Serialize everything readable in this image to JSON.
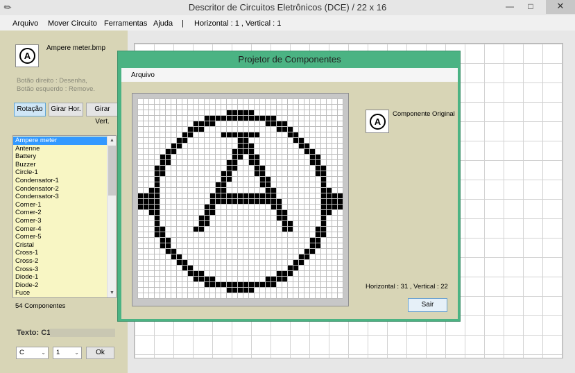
{
  "window": {
    "title": "Descritor de Circuitos Eletrônicos  (DCE) / 22 x 16",
    "min": "—",
    "max": "□",
    "close": "✕"
  },
  "menu": {
    "items": [
      "Arquivo",
      "Mover Circuito",
      "Ferramentas",
      "Ajuda"
    ],
    "separator": "|",
    "coords": "Horizontal : 1 , Vertical : 1"
  },
  "left": {
    "selected_icon_letter": "A",
    "selected_file": "Ampere meter.bmp",
    "hint1": "Botão direito : Desenha,",
    "hint2": "Botão esquerdo : Remove.",
    "buttons": [
      "Rotação",
      "Girar Hor.",
      "Girar Vert."
    ],
    "components": [
      "Ampere meter",
      "Antenne",
      "Battery",
      "Buzzer",
      "Circle-1",
      "Condensator-1",
      "Condensator-2",
      "Condensator-3",
      "Corner-1",
      "Corner-2",
      "Corner-3",
      "Corner-4",
      "Corner-5",
      "Cristal",
      "Cross-1",
      "Cross-2",
      "Cross-3",
      "Diode-1",
      "Diode-2",
      "Fuce"
    ],
    "scroll_up": "▲",
    "scroll_down": "▼",
    "count": "54 Componentes",
    "texto_label": "Texto: C1",
    "select1": "C",
    "select2": "1",
    "select_arrow": "⌄",
    "ok": "Ok"
  },
  "dialog": {
    "title": "Projetor de  Componentes",
    "menu": "Arquivo",
    "orig_letter": "A",
    "orig_label": "Componente Original",
    "coords": "Horizontal : 31 , Vertical : 22",
    "sair": "Sair"
  },
  "colors": {
    "dialog_border": "#4bb383",
    "panel_bg": "#d8d5b6",
    "selection": "#3399ff",
    "list_bg": "#f8f6c4"
  },
  "icons": {
    "app": "pencil-icon",
    "component": "ampere-meter-icon"
  }
}
